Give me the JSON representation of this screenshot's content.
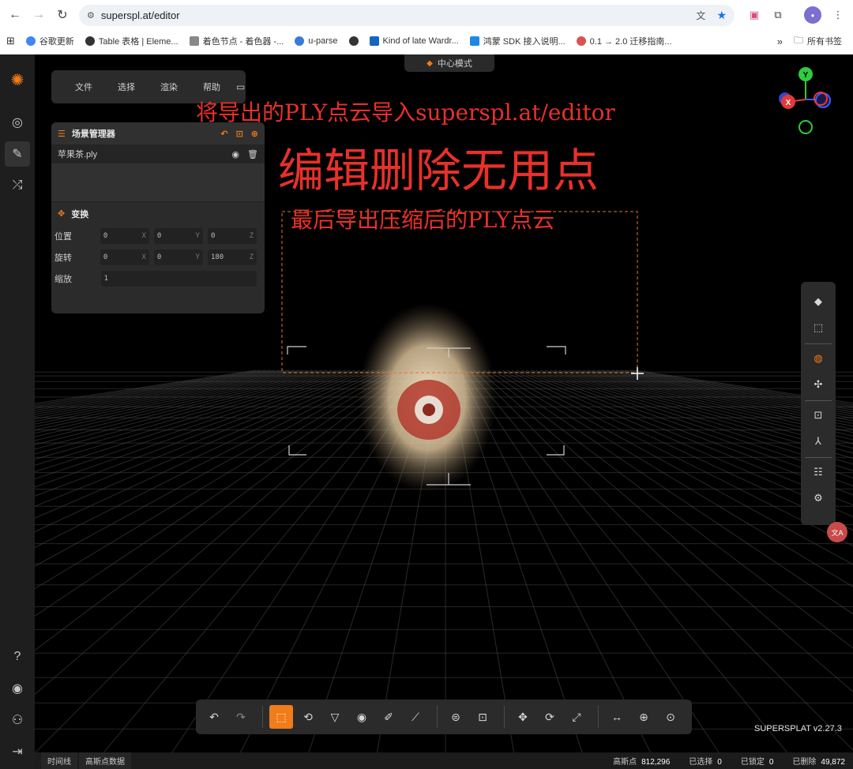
{
  "browser": {
    "url": "superspl.at/editor",
    "bookmarks": [
      {
        "label": "谷歌更新",
        "color": "#4285f4"
      },
      {
        "label": "Table 表格 | Eleme...",
        "color": "#333333"
      },
      {
        "label": "着色节点 - 着色器 -...",
        "color": "#888888"
      },
      {
        "label": "u-parse",
        "color": "#3a7bd5"
      },
      {
        "label": "Kind of late Wardr...",
        "color": "#333333"
      },
      {
        "label": "鸿蒙 SDK 接入说明...",
        "color": "#1e88e5"
      },
      {
        "label": "0.1 → 2.0 迁移指南...",
        "color": "#d9534f"
      }
    ],
    "all_bookmarks": "所有书签",
    "more": "»"
  },
  "app": {
    "center_mode": "中心模式",
    "menu": {
      "file": "文件",
      "select": "选择",
      "render": "渲染",
      "help": "帮助"
    },
    "scene": {
      "title": "场景管理器",
      "file_name": "苹果茶.ply",
      "transform_title": "变换",
      "position_label": "位置",
      "rotation_label": "旋转",
      "scale_label": "缩放",
      "position": {
        "x": "0",
        "y": "0",
        "z": "0"
      },
      "rotation": {
        "x": "0",
        "y": "0",
        "z": "180"
      },
      "scale": "1"
    },
    "axes": {
      "x": "X",
      "y": "Y",
      "z": "Z"
    },
    "version": "SUPERSPLAT v2.27.3",
    "status": {
      "tab_timeline": "时间线",
      "tab_splat_data": "高斯点数据",
      "splats_label": "高斯点",
      "splats_value": "812,296",
      "selected_label": "已选择",
      "selected_value": "0",
      "locked_label": "已锁定",
      "locked_value": "0",
      "deleted_label": "已删除",
      "deleted_value": "49,872"
    }
  },
  "overlay": {
    "line1": "将导出的PLY点云导入superspl.at/editor",
    "line2": "编辑删除无用点",
    "line3": "最后导出压缩后的PLY点云"
  },
  "colors": {
    "accent": "#f07c1a",
    "overlay_red": "#e8302a"
  }
}
